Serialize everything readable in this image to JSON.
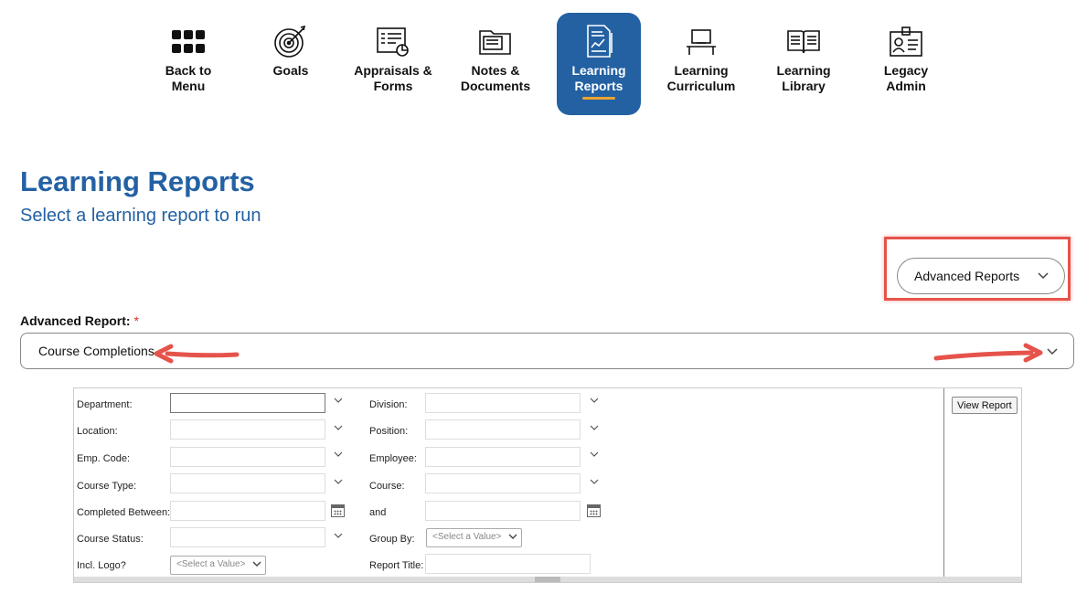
{
  "nav": {
    "items": [
      {
        "label": "Back to\nMenu",
        "icon": "grid-menu-icon"
      },
      {
        "label": "Goals",
        "icon": "target-icon"
      },
      {
        "label": "Appraisals &\nForms",
        "icon": "form-chart-icon"
      },
      {
        "label": "Notes &\nDocuments",
        "icon": "folder-icon"
      },
      {
        "label": "Learning\nReports",
        "icon": "report-icon",
        "active": true
      },
      {
        "label": "Learning\nCurriculum",
        "icon": "desk-computer-icon"
      },
      {
        "label": "Learning\nLibrary",
        "icon": "open-book-icon"
      },
      {
        "label": "Legacy\nAdmin",
        "icon": "id-badge-icon"
      }
    ],
    "active_color": "#2361a3",
    "underline_color": "#f0a330"
  },
  "page": {
    "title": "Learning Reports",
    "subtitle": "Select a learning report to run"
  },
  "report_type_dropdown": {
    "value": "Advanced Reports"
  },
  "advanced_report": {
    "label": "Advanced Report:",
    "required_mark": "*",
    "value": "Course Completions"
  },
  "params": {
    "department": "Department:",
    "division": "Division:",
    "location": "Location:",
    "position": "Position:",
    "emp_code": "Emp. Code:",
    "employee": "Employee:",
    "course_type": "Course Type:",
    "course": "Course:",
    "completed_between": "Completed Between:",
    "and": "and",
    "course_status": "Course Status:",
    "group_by": "Group By:",
    "group_by_value": "<Select a Value>",
    "incl_logo": "Incl. Logo?",
    "incl_logo_value": "<Select a Value>",
    "report_title": "Report Title:",
    "view_report": "View Report"
  },
  "colors": {
    "accent": "#2361a3",
    "highlight": "#e5534b",
    "required": "#d93025"
  }
}
